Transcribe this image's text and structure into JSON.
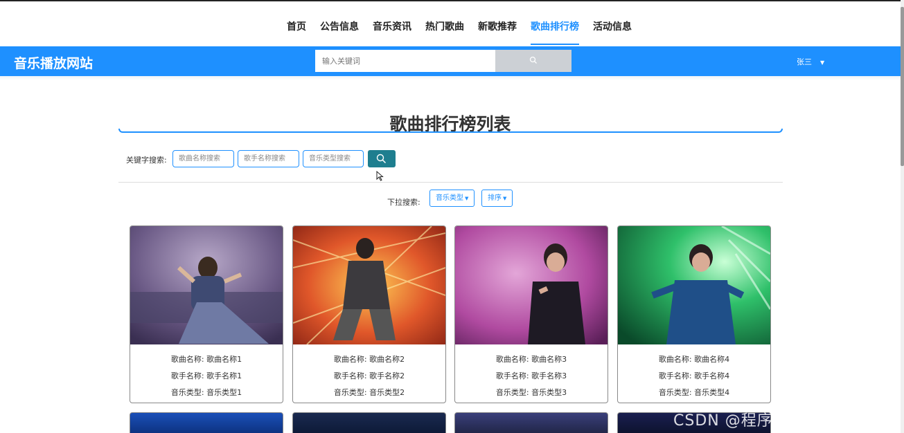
{
  "nav": {
    "items": [
      {
        "label": "首页"
      },
      {
        "label": "公告信息"
      },
      {
        "label": "音乐资讯"
      },
      {
        "label": "热门歌曲"
      },
      {
        "label": "新歌推荐"
      },
      {
        "label": "歌曲排行榜"
      },
      {
        "label": "活动信息"
      }
    ],
    "active_index": 5
  },
  "header": {
    "site_title": "音乐播放网站",
    "search_placeholder": "输入关键词",
    "search_icon": "search-icon",
    "user_name": "张三",
    "user_caret": "▼"
  },
  "main": {
    "title": "歌曲排行榜列表",
    "keyword_label": "关键字搜索:",
    "song_name_placeholder": "歌曲名称搜索",
    "singer_placeholder": "歌手名称搜索",
    "genre_placeholder": "音乐类型搜索",
    "dropdown_label": "下拉搜索:",
    "genre_dropdown": "音乐类型",
    "sort_dropdown": "排序",
    "caret": "▼"
  },
  "cards": [
    {
      "song_name": "歌曲名称: 歌曲名称1",
      "singer": "歌手名称: 歌手名称1",
      "genre": "音乐类型: 音乐类型1"
    },
    {
      "song_name": "歌曲名称: 歌曲名称2",
      "singer": "歌手名称: 歌手名称2",
      "genre": "音乐类型: 音乐类型2"
    },
    {
      "song_name": "歌曲名称: 歌曲名称3",
      "singer": "歌手名称: 歌手名称3",
      "genre": "音乐类型: 音乐类型3"
    },
    {
      "song_name": "歌曲名称: 歌曲名称4",
      "singer": "歌手名称: 歌手名称4",
      "genre": "音乐类型: 音乐类型4"
    }
  ],
  "watermark": "CSDN @程序设计计算机毕设",
  "colors": {
    "accent": "#1e90ff",
    "search_button": "#1e7e8f"
  }
}
